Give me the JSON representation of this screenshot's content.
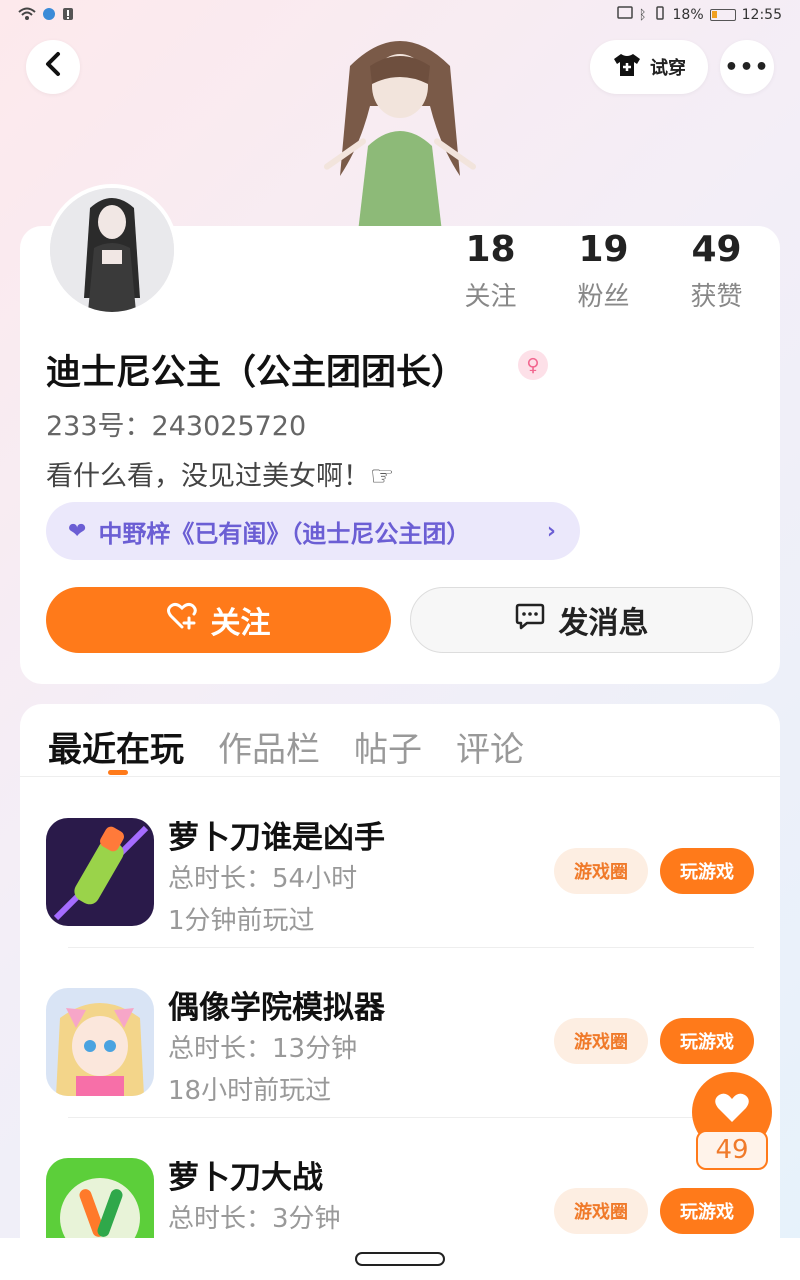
{
  "status_bar": {
    "time": "12:55",
    "battery": "18%"
  },
  "header": {
    "tryon_label": "试穿",
    "more_label": "•••"
  },
  "profile": {
    "stats": [
      {
        "value": "18",
        "label": "关注"
      },
      {
        "value": "19",
        "label": "粉丝"
      },
      {
        "value": "49",
        "label": "获赞"
      }
    ],
    "nickname": "迪士尼公主（公主团团长）",
    "gender_icon": "female-icon",
    "uid": "233号：243025720",
    "bio": "看什么看，没见过美女啊！☞",
    "group": "中野梓《已有闺》（迪士尼公主团）",
    "follow_label": "关注",
    "message_label": "发消息"
  },
  "tabs": [
    "最近在玩",
    "作品栏",
    "帖子",
    "评论"
  ],
  "games": [
    {
      "title": "萝卜刀谁是凶手",
      "duration": "总时长：54小时",
      "last": "1分钟前玩过",
      "circle": "游戏圈",
      "play": "玩游戏"
    },
    {
      "title": "偶像学院模拟器",
      "duration": "总时长：13分钟",
      "last": "18小时前玩过",
      "circle": "游戏圈",
      "play": "玩游戏"
    },
    {
      "title": "萝卜刀大战",
      "duration": "总时长：3分钟",
      "last": "",
      "circle": "游戏圈",
      "play": "玩游戏"
    }
  ],
  "float_like": {
    "count": "49"
  },
  "colors": {
    "accent": "#ff7a1a",
    "group_text": "#6b5ed4",
    "group_bg": "#ebe8fb"
  }
}
